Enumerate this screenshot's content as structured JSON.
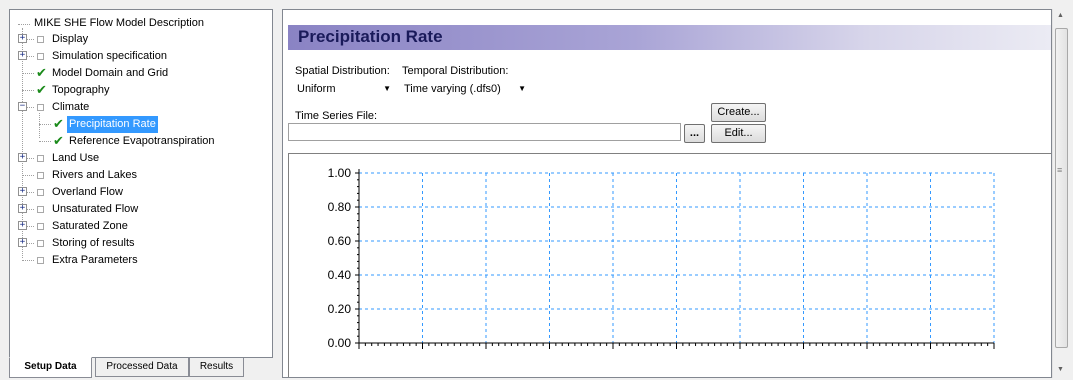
{
  "tree": {
    "root_label": "MIKE SHE Flow Model Description",
    "items": [
      {
        "label": "Display",
        "expander": "+",
        "state": "box"
      },
      {
        "label": "Simulation specification",
        "expander": "+",
        "state": "box"
      },
      {
        "label": "Model Domain and Grid",
        "expander": "",
        "state": "check"
      },
      {
        "label": "Topography",
        "expander": "",
        "state": "check"
      },
      {
        "label": "Climate",
        "expander": "−",
        "state": "box"
      },
      {
        "label": "Precipitation Rate",
        "expander": "",
        "state": "check",
        "selected": true
      },
      {
        "label": "Reference Evapotranspiration",
        "expander": "",
        "state": "check"
      },
      {
        "label": "Land Use",
        "expander": "+",
        "state": "box"
      },
      {
        "label": "Rivers and Lakes",
        "expander": "",
        "state": "box"
      },
      {
        "label": "Overland Flow",
        "expander": "+",
        "state": "box"
      },
      {
        "label": "Unsaturated Flow",
        "expander": "+",
        "state": "box"
      },
      {
        "label": "Saturated Zone",
        "expander": "+",
        "state": "box"
      },
      {
        "label": "Storing of results",
        "expander": "+",
        "state": "box"
      },
      {
        "label": "Extra Parameters",
        "expander": "",
        "state": "box"
      }
    ]
  },
  "tabs": [
    {
      "label": "Setup Data",
      "active": true
    },
    {
      "label": "Processed Data",
      "active": false
    },
    {
      "label": "Results",
      "active": false
    }
  ],
  "panel": {
    "title": "Precipitation Rate",
    "spatial_label": "Spatial Distribution:",
    "spatial_value": "Uniform",
    "temporal_label": "Temporal Distribution:",
    "temporal_value": "Time varying (.dfs0)",
    "timeseries_label": "Time Series File:",
    "timeseries_value": "",
    "browse_label": "...",
    "create_label": "Create...",
    "edit_label": "Edit..."
  },
  "chart_data": {
    "type": "line",
    "title": "",
    "xlabel": "",
    "ylabel": "",
    "ylim": [
      0,
      1
    ],
    "yticks": [
      "1.00",
      "0.80",
      "0.60",
      "0.40",
      "0.20",
      "0.00"
    ],
    "x_gridlines": 10,
    "grid": true,
    "series": []
  },
  "colors": {
    "header_gradient_start": "#8a83c4",
    "selection": "#3399ff",
    "check": "#1a8a1a",
    "grid_blue": "#3399ff"
  }
}
